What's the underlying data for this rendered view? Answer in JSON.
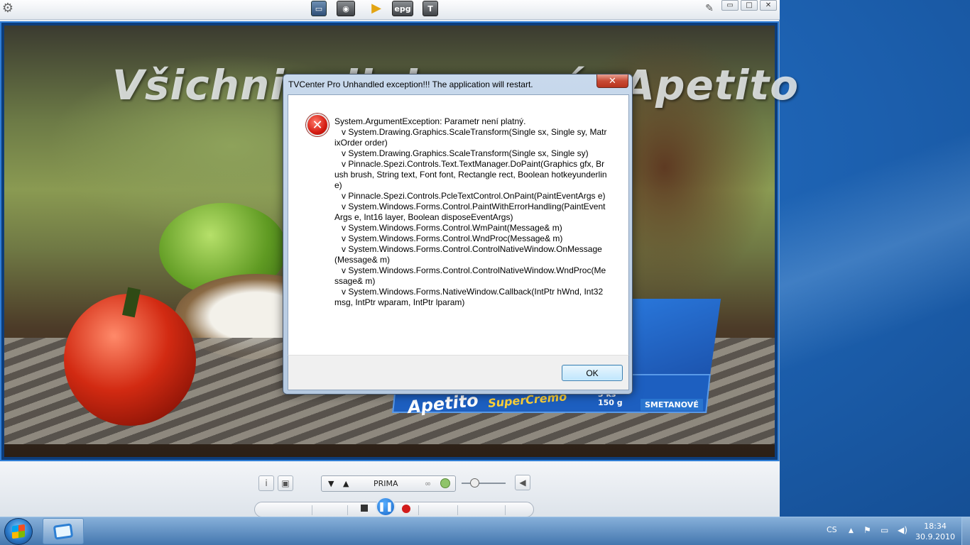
{
  "desktop": {
    "accent": "#1f66b8"
  },
  "player": {
    "toolbar_icons": [
      "settings-icon",
      "monitor-icon",
      "camera-icon",
      "play-guide-icon",
      "epg-icon",
      "teletext-icon"
    ],
    "epg_label": "epg",
    "teletext_label": "T",
    "window_controls": {
      "pin": "pin-icon",
      "minimize": "▭",
      "maximize": "□",
      "close": "✕"
    },
    "video": {
      "overlay_text": "Všichni milujeme sýr Apetito",
      "brand": "Apetito",
      "brand_line": "SuperCremo",
      "weight": "3 ks\n150 g",
      "variant": "SMETANOVÉ"
    },
    "channel": {
      "name": "PRIMA",
      "down_label": "▼",
      "up_label": "▲"
    },
    "volume_level": 0.3
  },
  "dialog": {
    "title": "TVCenter Pro Unhandled exception!!! The application will restart.",
    "close_label": "✕",
    "message": "System.ArgumentException: Parametr není platný.\n   v System.Drawing.Graphics.ScaleTransform(Single sx, Single sy, MatrixOrder order)\n   v System.Drawing.Graphics.ScaleTransform(Single sx, Single sy)\n   v Pinnacle.Spezi.Controls.Text.TextManager.DoPaint(Graphics gfx, Brush brush, String text, Font font, Rectangle rect, Boolean hotkeyunderline)\n   v Pinnacle.Spezi.Controls.PcleTextControl.OnPaint(PaintEventArgs e)\n   v System.Windows.Forms.Control.PaintWithErrorHandling(PaintEventArgs e, Int16 layer, Boolean disposeEventArgs)\n   v System.Windows.Forms.Control.WmPaint(Message& m)\n   v System.Windows.Forms.Control.WndProc(Message& m)\n   v System.Windows.Forms.Control.ControlNativeWindow.OnMessage(Message& m)\n   v System.Windows.Forms.Control.ControlNativeWindow.WndProc(Message& m)\n   v System.Windows.Forms.NativeWindow.Callback(IntPtr hWnd, Int32 msg, IntPtr wparam, IntPtr lparam)",
    "ok_label": "OK",
    "icon": "error-icon"
  },
  "taskbar": {
    "language": "CS",
    "tray_icons": [
      "show-hidden-icons-icon",
      "action-center-icon",
      "network-icon",
      "volume-icon"
    ],
    "time": "18:34",
    "date": "30.9.2010"
  }
}
